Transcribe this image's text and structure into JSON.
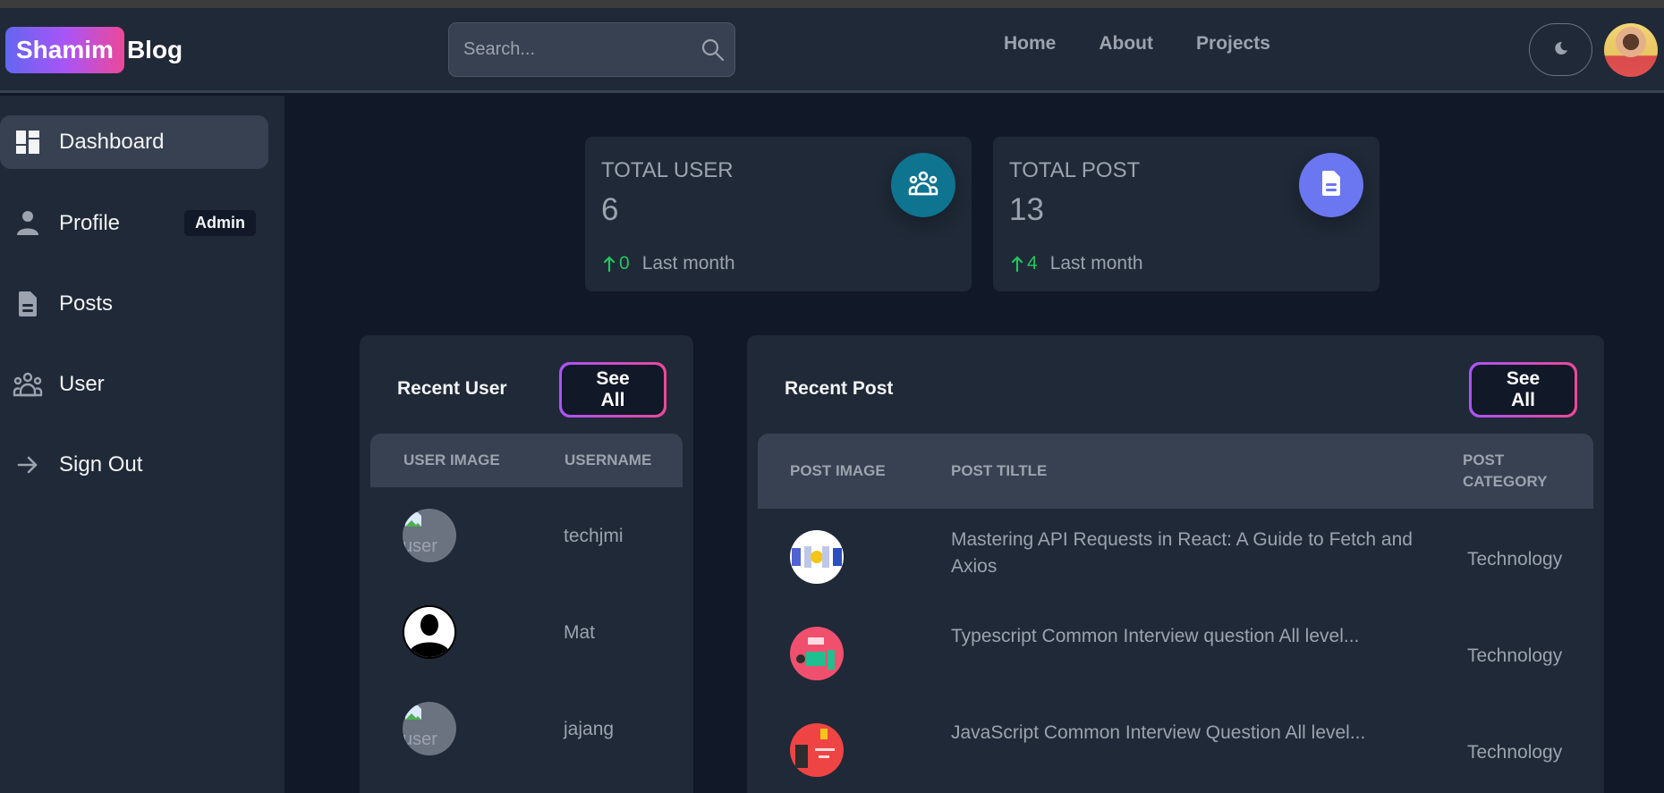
{
  "navbar": {
    "logo_badge": "Shamim",
    "logo_rest": "Blog",
    "search_placeholder": "Search...",
    "links": [
      "Home",
      "About",
      "Projects"
    ],
    "theme_toggle_icon": "moon-icon",
    "avatar_alt": "user avatar"
  },
  "sidebar": {
    "items": [
      {
        "label": "Dashboard",
        "icon": "dashboard-icon",
        "active": true
      },
      {
        "label": "Profile",
        "icon": "user-icon",
        "badge": "Admin"
      },
      {
        "label": "Posts",
        "icon": "document-icon"
      },
      {
        "label": "User",
        "icon": "users-group-icon"
      },
      {
        "label": "Sign Out",
        "icon": "arrow-right-icon"
      }
    ]
  },
  "stats": [
    {
      "title": "TOTAL USER",
      "value": "6",
      "delta": "0",
      "period": "Last month",
      "icon": "users-group-icon",
      "color": "#0e7490"
    },
    {
      "title": "TOTAL POST",
      "value": "13",
      "delta": "4",
      "period": "Last month",
      "icon": "document-icon",
      "color": "#6366f1"
    }
  ],
  "recent_users": {
    "title": "Recent User",
    "see_all": "See All",
    "columns": [
      "User Image",
      "Username"
    ],
    "rows": [
      {
        "image": "broken",
        "alt": "user",
        "username": "techjmi"
      },
      {
        "image": "silhouette",
        "alt": "user",
        "username": "Mat"
      },
      {
        "image": "broken",
        "alt": "user",
        "username": "jajang"
      }
    ]
  },
  "recent_posts": {
    "title": "Recent Post",
    "see_all": "See All",
    "columns": [
      "Post Image",
      "Post Tiltle",
      "Post Category"
    ],
    "rows": [
      {
        "title": "Mastering API Requests in React: A Guide to Fetch and Axios",
        "category": "Technology",
        "thumb_color": "#ffffff"
      },
      {
        "title": "Typescript Common Interview question All level...",
        "category": "Technology",
        "thumb_color": "#f0506e"
      },
      {
        "title": "JavaScript Common Interview Question All level...",
        "category": "Technology",
        "thumb_color": "#ef4444"
      }
    ]
  },
  "colors": {
    "accent_gradient_start": "#6366f1",
    "accent_gradient_mid": "#a855f7",
    "accent_gradient_end": "#ec4899",
    "positive": "#22c55e"
  }
}
